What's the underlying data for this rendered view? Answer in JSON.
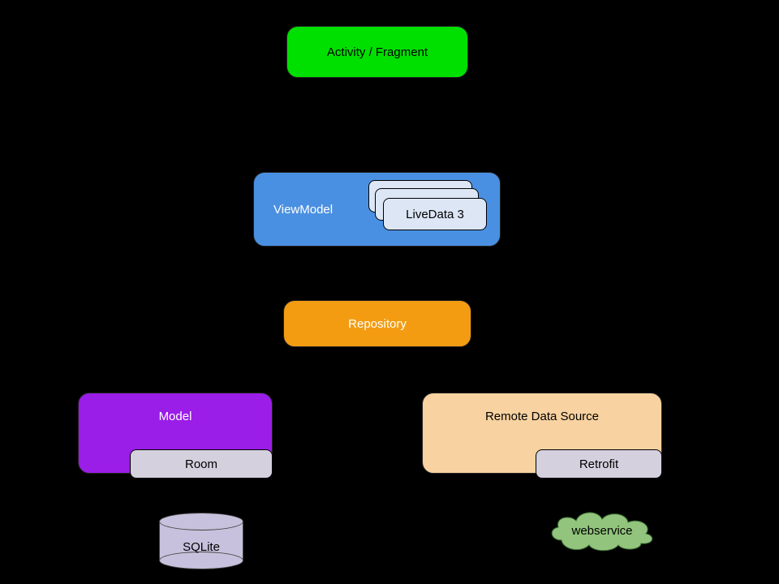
{
  "nodes": {
    "activity": "Activity / Fragment",
    "viewmodel": "ViewModel",
    "livedata_front": "LiveData 3",
    "repository": "Repository",
    "model": "Model",
    "room": "Room",
    "remote": "Remote Data Source",
    "retrofit": "Retrofit",
    "sqlite": "SQLite",
    "webservice": "webservice"
  },
  "colors": {
    "activity": "#00e000",
    "viewmodel": "#4a90e2",
    "livedata": "#dce6f5",
    "repository": "#f39c12",
    "model": "#9b1de8",
    "remote": "#f8d2a0",
    "gray": "#d4d0de",
    "cloud": "#92c47d"
  }
}
